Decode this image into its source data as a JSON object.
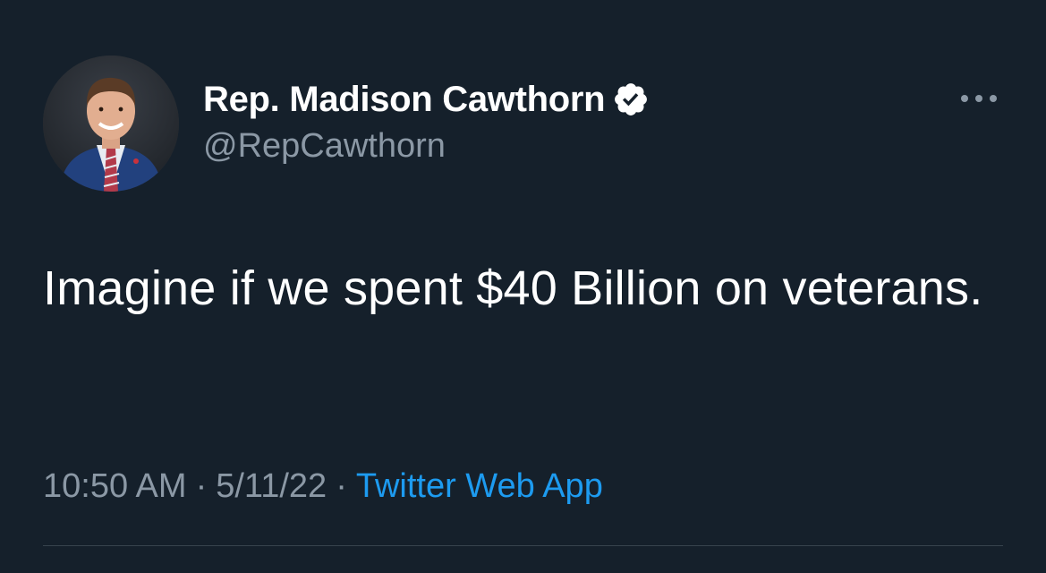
{
  "tweet": {
    "author": {
      "display_name": "Rep. Madison Cawthorn",
      "handle": "@RepCawthorn",
      "verified": true,
      "avatar": "profile-photo"
    },
    "text": "Imagine if we spent $40 Billion on veterans.",
    "time": "10:50 AM",
    "date": "5/11/22",
    "separator": "·",
    "source": "Twitter Web App",
    "icons": {
      "more": "more-horizontal-icon",
      "verified": "verified-badge-icon"
    }
  },
  "colors": {
    "background": "#15202b",
    "primary_text": "#ffffff",
    "secondary_text": "#8b98a5",
    "link": "#1d9bf0",
    "divider": "#38444d"
  }
}
